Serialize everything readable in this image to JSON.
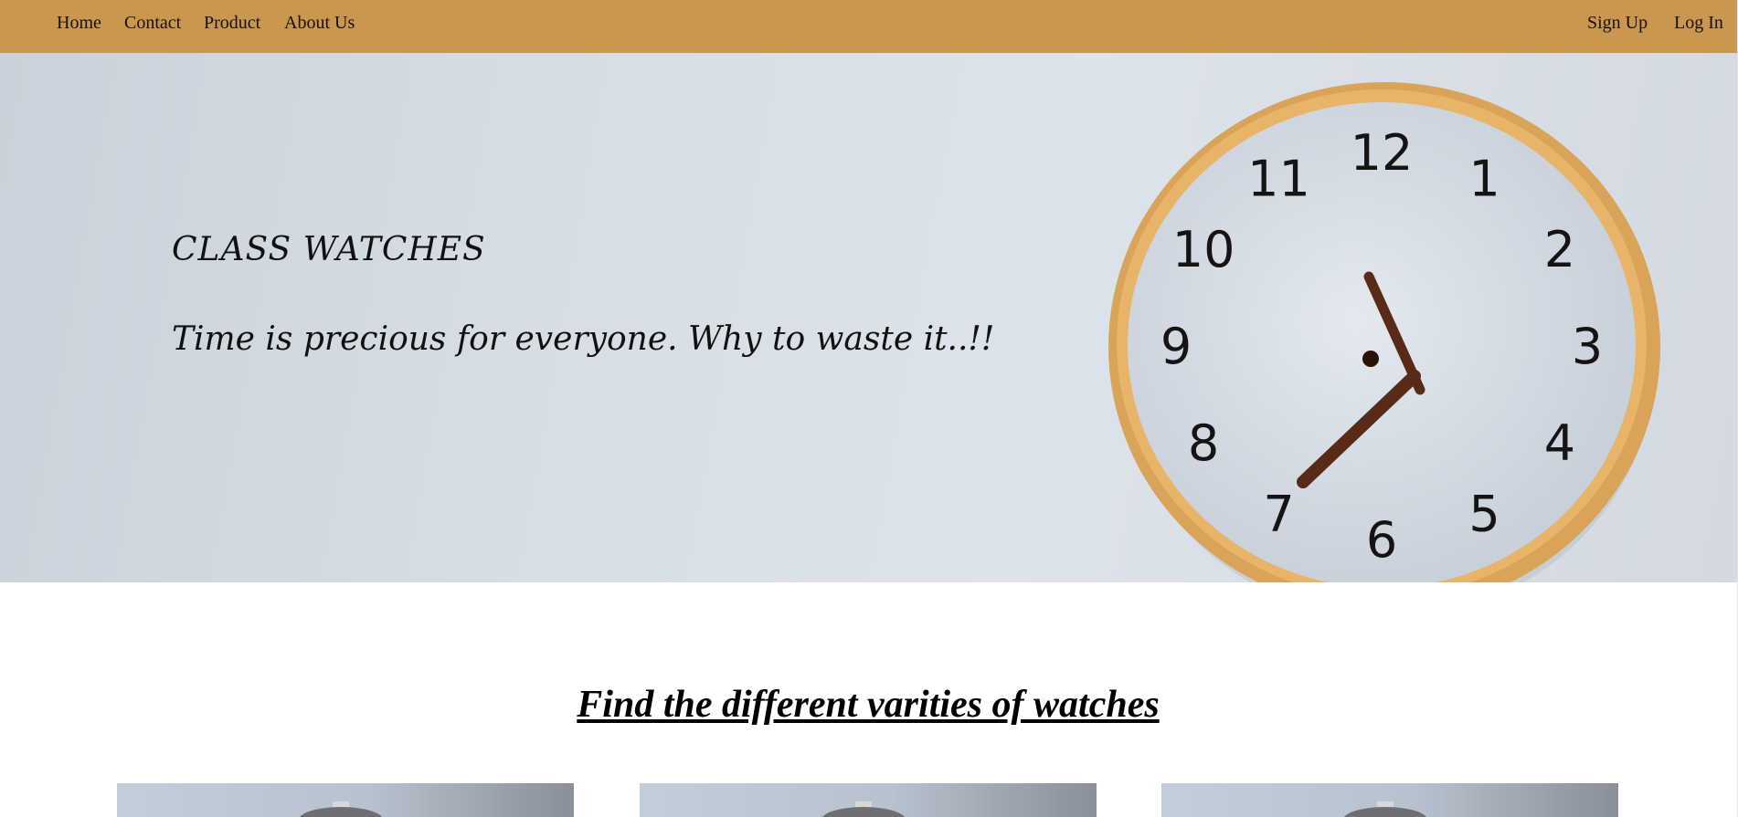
{
  "nav": {
    "home": "Home",
    "contact": "Contact",
    "product": "Product",
    "about": "About Us",
    "signup": "Sign Up",
    "login": "Log In"
  },
  "hero": {
    "title": "CLASS WATCHES",
    "tagline": "Time is precious for everyone. Why to waste it..!!",
    "clock_numerals": [
      "12",
      "1",
      "2",
      "3",
      "4",
      "5",
      "6",
      "7",
      "8",
      "9",
      "10",
      "11"
    ]
  },
  "section": {
    "heading": "Find the different varities of watches"
  },
  "colors": {
    "navbar": "#c9974f",
    "clock_rim": "#d9a35a",
    "clock_hands": "#5a2a18"
  }
}
